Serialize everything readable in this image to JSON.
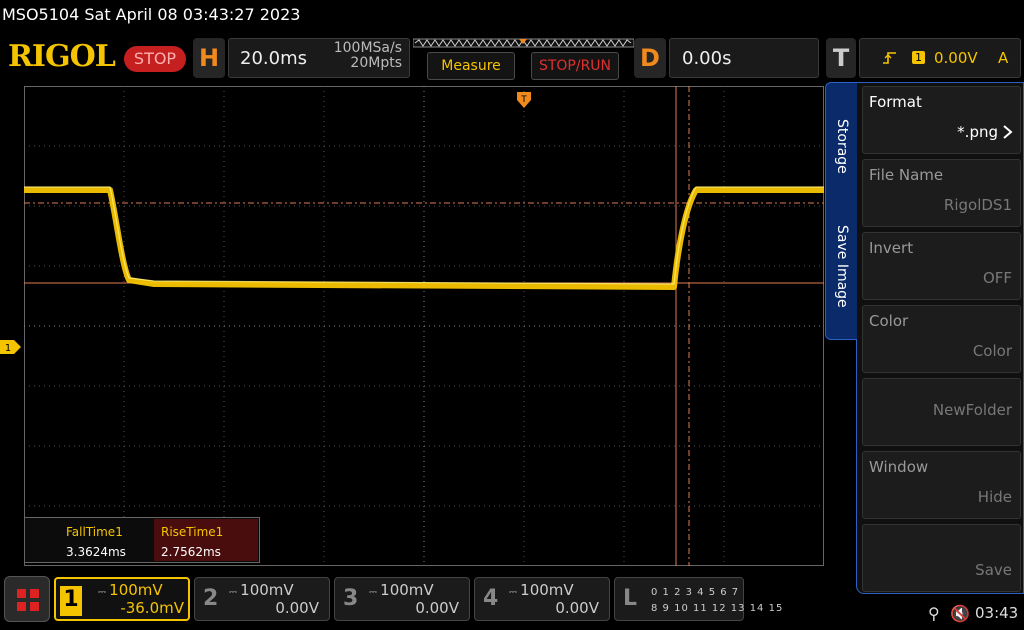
{
  "header": {
    "title": "MSO5104  Sat April 08 03:43:27 2023",
    "logo": "RIGOL",
    "run_state": "STOP"
  },
  "horizontal": {
    "letter": "H",
    "timebase": "20.0ms",
    "sample_rate": "100MSa/s",
    "memory_depth": "20Mpts"
  },
  "toolbar": {
    "measure_label": "Measure",
    "stop_run_label": "STOP/RUN"
  },
  "delay": {
    "letter": "D",
    "value": "0.00s"
  },
  "trigger": {
    "letter": "T",
    "source": "1",
    "level": "0.00V",
    "mode": "A"
  },
  "measurements": {
    "fall_label": "FallTime1",
    "fall_value": "3.3624ms",
    "rise_label": "RiseTime1",
    "rise_value": "2.7562ms"
  },
  "sidebar": {
    "tab_storage": "Storage",
    "tab_save_image": "Save Image",
    "items": [
      {
        "title": "Format",
        "value": "*.png",
        "active": true
      },
      {
        "title": "File Name",
        "value": "RigolDS1",
        "active": false
      },
      {
        "title": "Invert",
        "value": "OFF",
        "active": false
      },
      {
        "title": "Color",
        "value": "Color",
        "active": false
      },
      {
        "title": "",
        "value": "NewFolder",
        "active": false
      },
      {
        "title": "Window",
        "value": "Hide",
        "active": false
      },
      {
        "title": "",
        "value": "Save",
        "active": false
      }
    ]
  },
  "channels": [
    {
      "num": "1",
      "scale": "100mV",
      "offset": "-36.0mV",
      "active": true
    },
    {
      "num": "2",
      "scale": "100mV",
      "offset": "0.00V",
      "active": false
    },
    {
      "num": "3",
      "scale": "100mV",
      "offset": "0.00V",
      "active": false
    },
    {
      "num": "4",
      "scale": "100mV",
      "offset": "0.00V",
      "active": false
    }
  ],
  "logic": {
    "letter": "L",
    "digits_row1": "0 1 2 3   4 5 6 7",
    "digits_row2": "8 9 10 11  12 13 14 15"
  },
  "status": {
    "clock": "03:43"
  },
  "ch1_marker": "1",
  "colors": {
    "ch1": "#f5c400",
    "accent": "#f08a1c",
    "stop": "#c51f1f",
    "menu_border": "#2d5fc4"
  }
}
